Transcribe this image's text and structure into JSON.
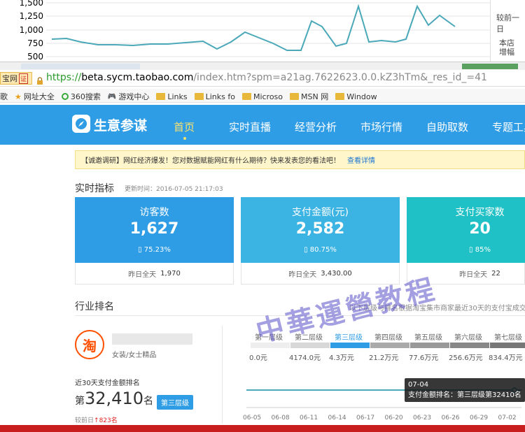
{
  "top_chart": {
    "yticks": [
      "1,500",
      "1,250",
      "1,000",
      "750",
      "500"
    ],
    "side_text_1": "较前一日",
    "side_text_2": "本店",
    "side_text_3": "增幅"
  },
  "browser": {
    "url_prefix": "https://",
    "url_domain": "beta.sycm.taobao.com",
    "url_rest": "/index.htm?spm=a21ag.7622623.0.0.kZ3hTm&_res_id_=41",
    "left_tab_text": "宝网",
    "left_tab_badge": "证",
    "bookmarks": [
      "网址大全",
      "360搜索",
      "游戏中心",
      "Links",
      "Links fo",
      "Microso",
      "MSN 网",
      "Window"
    ],
    "bookmark_prefix": "歌"
  },
  "nav": {
    "logo_text": "生意参谋",
    "items": [
      "首页",
      "实时直播",
      "经营分析",
      "市场行情",
      "自助取数",
      "专题工具"
    ]
  },
  "notice": {
    "text": "【诚邀调研】网红经济爆发！您对数据赋能网红有什么期待？快来发表您的看法吧！",
    "link": "查看详情"
  },
  "realtime": {
    "title": "实时指标",
    "updated_label": "更新时间：",
    "updated_time": "2016-07-05 21:17:03",
    "cards": [
      {
        "label": "访客数",
        "value": "1,627",
        "pct": "75.23%",
        "foot_label": "昨日全天",
        "foot_value": "1,970",
        "color": "#2f9de5"
      },
      {
        "label": "支付金额(元)",
        "value": "2,582",
        "pct": "80.75%",
        "foot_label": "昨日全天",
        "foot_value": "3,430.00",
        "color": "#3bb3e3"
      },
      {
        "label": "支付买家数",
        "value": "20",
        "pct": "85%",
        "foot_label": "昨日全天",
        "foot_value": "22",
        "color": "#1fc1c6"
      }
    ]
  },
  "industry": {
    "title": "行业排名",
    "desc": "以下层级与排名根据淘宝集市商家最近30天的支付宝成交",
    "store_icon": "淘",
    "category": "女装/女士精品",
    "rank_label": "近30天支付金额排名",
    "rank_prefix": "第",
    "rank_value": "32,410",
    "rank_suffix": "名",
    "tier_badge": "第三层级",
    "compare_label": "较前日",
    "compare_value": "823名",
    "tiers": [
      "第一层级",
      "第二层级",
      "第三层级",
      "第四层级",
      "第五层级",
      "第六层级",
      "第七层级"
    ],
    "tier_values": [
      "0.0元",
      "4174.0元",
      "4.3万元",
      "21.2万元",
      "77.6万元",
      "256.6万元",
      "834.4万元"
    ],
    "x_labels": [
      "06-05",
      "06-08",
      "06-11",
      "06-14",
      "06-17",
      "06-20",
      "06-23",
      "06-26",
      "06-29",
      "07-02"
    ],
    "tooltip_date": "07-04",
    "tooltip_text": "支付金额排名：第三层级第32410名",
    "watermark": "中華運營教程"
  },
  "colors": {
    "accent": "#2f9de5",
    "line": "#4aa8b8",
    "highlight": "#ffe36b",
    "red": "#e02020"
  }
}
